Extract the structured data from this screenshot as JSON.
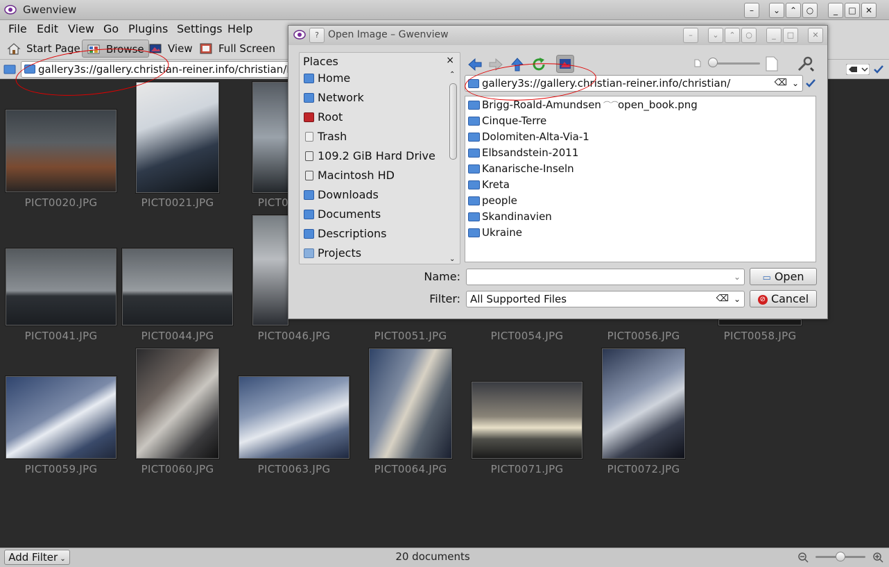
{
  "window": {
    "title": "Gwenview"
  },
  "menu": [
    "File",
    "Edit",
    "View",
    "Go",
    "Plugins",
    "Settings",
    "Help"
  ],
  "toolbar": {
    "start_page": "Start Page",
    "browse": "Browse",
    "view": "View",
    "full_screen": "Full Screen"
  },
  "location": {
    "url": "gallery3s://gallery.christian-reiner.info/christian/Bri"
  },
  "thumbnails": [
    "PICT0020.JPG",
    "PICT0021.JPG",
    "PICT0",
    "PICT0041.JPG",
    "PICT0044.JPG",
    "PICT0046.JPG",
    "PICT0051.JPG",
    "PICT0054.JPG",
    "PICT0056.JPG",
    "PICT0058.JPG",
    "PICT0059.JPG",
    "PICT0060.JPG",
    "PICT0063.JPG",
    "PICT0064.JPG",
    "PICT0071.JPG",
    "PICT0072.JPG"
  ],
  "statusbar": {
    "add_filter": "Add Filter",
    "document_count": "20 documents"
  },
  "dialog": {
    "title": "Open Image – Gwenview",
    "help_label": "?",
    "places_header": "Places",
    "places": [
      "Home",
      "Network",
      "Root",
      "Trash",
      "109.2 GiB Hard Drive",
      "Macintosh HD",
      "Downloads",
      "Documents",
      "Descriptions",
      "Projects"
    ],
    "url": "gallery3s://gallery.christian-reiner.info/christian/",
    "folders": [
      "Brigg-Roald-Amundsen",
      "Cinque-Terre",
      "Dolomiten-Alta-Via-1",
      "Elbsandstein-2011",
      "Kanarische-Inseln",
      "Kreta",
      "people",
      "Skandinavien",
      "Ukraine"
    ],
    "file_item": "open_book.png",
    "name_label": "Name:",
    "name_value": "",
    "filter_label": "Filter:",
    "filter_value": "All Supported Files",
    "open_button": "Open",
    "cancel_button": "Cancel"
  },
  "colors": {
    "annotation": "#e00000",
    "folder": "#4f8bd8",
    "thumb_label": "#8e8e8e"
  }
}
